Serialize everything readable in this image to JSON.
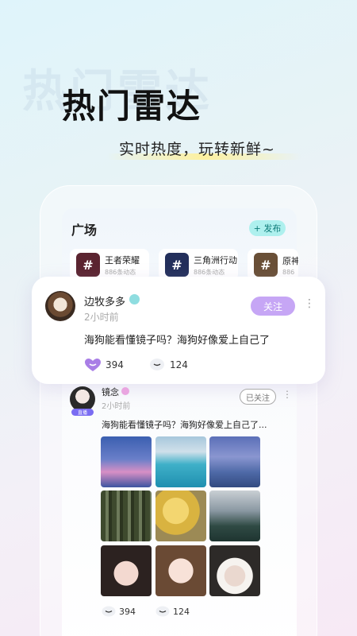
{
  "hero": {
    "ghost_text": "热门雷达",
    "title": "热门雷达",
    "subtitle": "实时热度，玩转新鲜~"
  },
  "plaza": {
    "title": "广场",
    "publish_label": "+ 发布"
  },
  "topics": [
    {
      "name": "王者荣耀",
      "sub": "886条动态",
      "color": "#7a3040",
      "icon": "hash-icon"
    },
    {
      "name": "三角洲行动",
      "sub": "886条动态",
      "color": "#2f3f7a",
      "icon": "hash-icon"
    },
    {
      "name": "原神",
      "sub": "886",
      "color": "#8c6a48",
      "icon": "hash-icon"
    }
  ],
  "featured_post": {
    "username": "边牧多多",
    "time": "2小时前",
    "follow_label": "关注",
    "text": "海狗能看懂镜子吗？海狗好像爱上自己了",
    "likes": "394",
    "comments": "124",
    "like_color": "#a97ee6"
  },
  "post2": {
    "username": "镜念",
    "time": "2小时前",
    "followed_label": "已关注",
    "live_label": "直播",
    "text": "海狗能看懂镜子吗？海狗好像爱上自己了...",
    "likes": "394",
    "comments": "124"
  }
}
